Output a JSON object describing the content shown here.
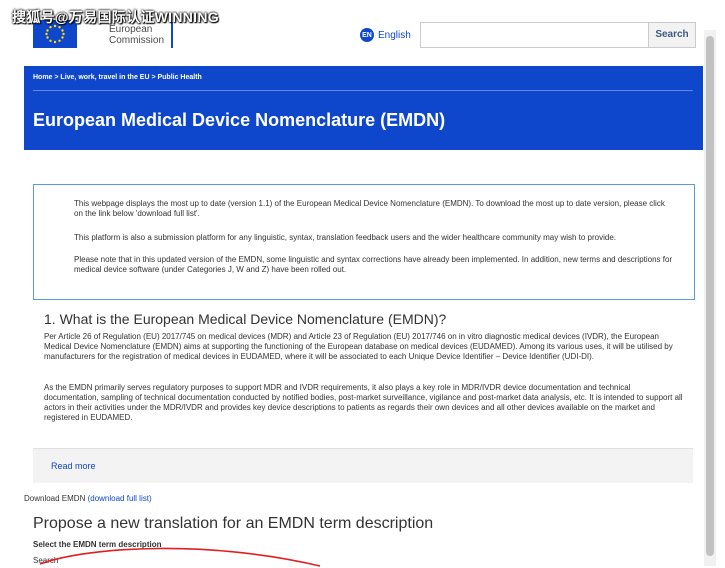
{
  "watermark": "搜狐号@万易国际认证WINNING",
  "header": {
    "logo_line1": "European",
    "logo_line2": "Commission",
    "lang_code": "EN",
    "lang_label": "English",
    "search_placeholder": "",
    "search_button": "Search"
  },
  "banner": {
    "breadcrumb": "Home  >  Live, work, travel in the EU  >  Public Health",
    "title": "European Medical Device Nomenclature (EMDN)"
  },
  "notice": {
    "p1": "This webpage displays the most up to date (version 1.1) of the European Medical Device Nomenclature (EMDN). To download the most up to date version, please click on the link below 'download full list'.",
    "p2": "This platform is also a submission platform for any linguistic, syntax, translation feedback users and the wider healthcare community may wish to provide.",
    "p3": "Please note that in this updated version of the EMDN, some linguistic and syntax corrections have already been implemented. In addition, new terms and descriptions for medical device software (under Categories J, W and Z) have been rolled out."
  },
  "section": {
    "title": "1. What is the European Medical Device Nomenclature (EMDN)?",
    "p1": "Per Article 26 of Regulation (EU) 2017/745 on medical devices (MDR) and Article 23 of Regulation (EU) 2017/746 on in vitro diagnostic medical devices (IVDR), the European Medical Device Nomenclature (EMDN) aims at supporting the functioning of the European database on medical devices (EUDAMED). Among its various uses, it will be utilised by manufacturers for the registration of medical devices in EUDAMED, where it will be associated to each Unique Device Identifier – Device Identifier (UDI-DI).",
    "p2": "As the EMDN primarily serves regulatory purposes to support MDR and IVDR requirements, it also plays a key role in MDR/IVDR device documentation and technical documentation, sampling of technical documentation conducted by notified bodies, post-market surveillance, vigilance and post-market data analysis, etc. It is intended to support all actors in their activities under the MDR/IVDR and provides key device descriptions to patients as regards their own devices and all other devices available on the market and registered in EUDAMED.",
    "read_more": "Read more"
  },
  "download": {
    "label": "Download EMDN",
    "link": "(download full list)"
  },
  "propose": {
    "title": "Propose a new translation for an EMDN term description",
    "select_label": "Select the EMDN term description",
    "search_label": "Search"
  },
  "colors": {
    "ec_blue": "#0e47cb",
    "notice_border": "#5b9bd5",
    "annotation_red": "#e02020"
  }
}
